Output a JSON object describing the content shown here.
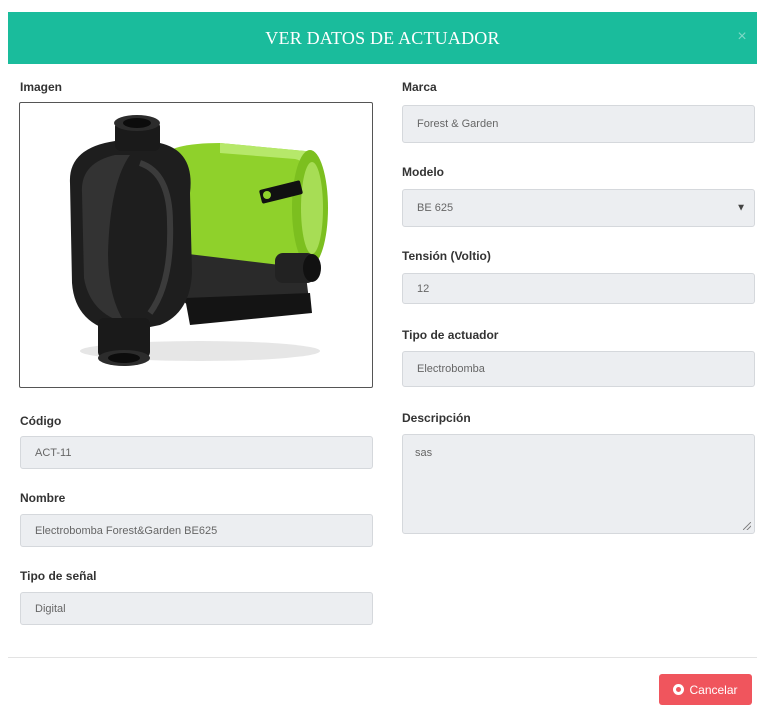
{
  "modal": {
    "title": "VER DATOS DE ACTUADOR",
    "close_label": "×"
  },
  "left": {
    "image_label": "Imagen",
    "image_alt": "Electrobomba",
    "codigo_label": "Código",
    "codigo_value": "ACT-11",
    "nombre_label": "Nombre",
    "nombre_value": "Electrobomba Forest&Garden BE625",
    "tipo_senal_label": "Tipo de señal",
    "tipo_senal_value": "Digital"
  },
  "right": {
    "marca_label": "Marca",
    "marca_value": "Forest & Garden",
    "modelo_label": "Modelo",
    "modelo_value": "BE 625",
    "tension_label": "Tensión (Voltio)",
    "tension_value": "12",
    "tipo_actuador_label": "Tipo de actuador",
    "tipo_actuador_value": "Electrobomba",
    "descripcion_label": "Descripción",
    "descripcion_value": "sas"
  },
  "footer": {
    "cancel_label": "Cancelar"
  },
  "colors": {
    "header": "#1abc9c",
    "cancel": "#f0555d",
    "field_bg": "#eceef1",
    "pump_green": "#8fd12b",
    "pump_black": "#1e1e1e"
  },
  "icons": {
    "close": "close-icon",
    "select": "chevron-down-icon",
    "cancel": "circle-icon"
  }
}
